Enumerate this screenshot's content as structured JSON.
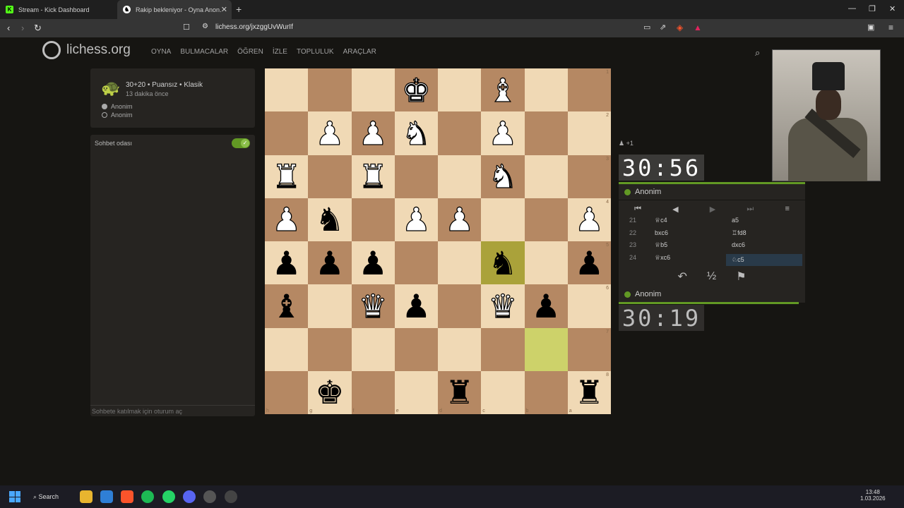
{
  "browser": {
    "tabs": [
      {
        "label": "Stream - Kick Dashboard",
        "active": false
      },
      {
        "label": "Rakip bekleniyor - Oyna Anon.",
        "active": true
      }
    ],
    "url": "lichess.org/jxzggUvWurIf"
  },
  "site": {
    "logo": "lichess.org",
    "nav": [
      "OYNA",
      "BULMACALAR",
      "ÖĞREN",
      "İZLE",
      "TOPLULUK",
      "ARAÇLAR"
    ]
  },
  "game_info": {
    "title": "30+20 • Puansız • Klasik",
    "ago": "13 dakika önce",
    "players": [
      "Anonim",
      "Anonim"
    ]
  },
  "chat": {
    "title": "Sohbet odası",
    "input_placeholder": "Sohbete katılmak için oturum aç"
  },
  "board": {
    "ranks": [
      "1",
      "2",
      "3",
      "4",
      "5",
      "6",
      "7",
      "8"
    ],
    "files": [
      "h",
      "g",
      "f",
      "e",
      "d",
      "c",
      "b",
      "a"
    ],
    "rows": [
      [
        "",
        "",
        "",
        "wK",
        "",
        "wB",
        "",
        ""
      ],
      [
        "",
        "wP",
        "wP",
        "wN",
        "",
        "wP",
        "",
        ""
      ],
      [
        "wR",
        "",
        "wR",
        "",
        "",
        "wN",
        "",
        ""
      ],
      [
        "wP",
        "bN",
        "",
        "wP",
        "wP",
        "",
        "",
        "wP"
      ],
      [
        "bP",
        "bP",
        "bP",
        "",
        "",
        "bN",
        "",
        "bP"
      ],
      [
        "bB",
        "",
        "wQ",
        "bP",
        "",
        "wQ",
        "bP",
        ""
      ],
      [
        "",
        "",
        "",
        "",
        "",
        "",
        "",
        ""
      ],
      [
        "",
        "bK",
        "",
        "",
        "bR",
        "",
        "",
        "bR"
      ]
    ]
  },
  "material_diff": "+1",
  "clocks": {
    "top": "30:56",
    "bottom": "30:19"
  },
  "players": {
    "top": "Anonim",
    "bottom": "Anonim"
  },
  "moves": [
    {
      "n": "21",
      "w": "♕c4",
      "b": "a5"
    },
    {
      "n": "22",
      "w": "bxc6",
      "b": "♖fd8"
    },
    {
      "n": "23",
      "w": "♕b5",
      "b": "dxc6"
    },
    {
      "n": "24",
      "w": "♕xc6",
      "b": "♘c5"
    }
  ],
  "actions": {
    "takeback": "↶",
    "draw": "½",
    "resign": "⚑"
  },
  "taskbar": {
    "search": "Search",
    "time": "13:48",
    "date": "1.03.2026"
  }
}
